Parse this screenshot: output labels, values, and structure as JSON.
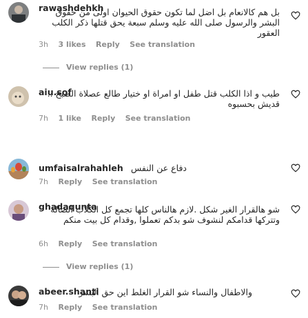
{
  "comments": [
    {
      "username": "rawashdehkh",
      "text": "بل هم كالانعام بل اضل لما تكون حقوق الحيوان اولى من حقوق البشر والرسول صلى الله عليه وسلم سبعة يحق قتلها ذكر الكلب العقور",
      "time": "3h",
      "likes": "3 likes",
      "reply": "Reply",
      "see_translation": "See translation",
      "view_replies": "View replies (1)"
    },
    {
      "username": "aiu.sof",
      "text": "طيب و اذا الكلب قتل طفل او امراة او ختيار طالع عصلاة الصبح .. قديش بحسبوه",
      "time": "7h",
      "likes": "1 like",
      "reply": "Reply",
      "see_translation": "See translation"
    },
    {
      "username": "umfaisalrahahleh",
      "text": "دفاع عن النفس",
      "time": "7h",
      "reply": "Reply",
      "see_translation": "See translation"
    },
    {
      "username": "ghadaqunta",
      "text": "شو هالقرار الغير شكل .لازم هالناس كلها تجمع كل الكلاب الضالة وتتركها قدامكم لنشوف شو بدكم تعملوا ,وقدام كل بيت منكم",
      "time": "6h",
      "reply": "Reply",
      "see_translation": "See translation",
      "view_replies": "View replies (1)"
    },
    {
      "username": "abeer.shanti",
      "text": "والاطفال والنساء شو القرار الغلط اين حق البشر",
      "time": "7h",
      "reply": "Reply",
      "see_translation": "See translation"
    }
  ],
  "colors": {
    "text": "#262626",
    "secondary": "#8e8e8e"
  },
  "icons": {
    "like": "heart-outline-icon"
  }
}
